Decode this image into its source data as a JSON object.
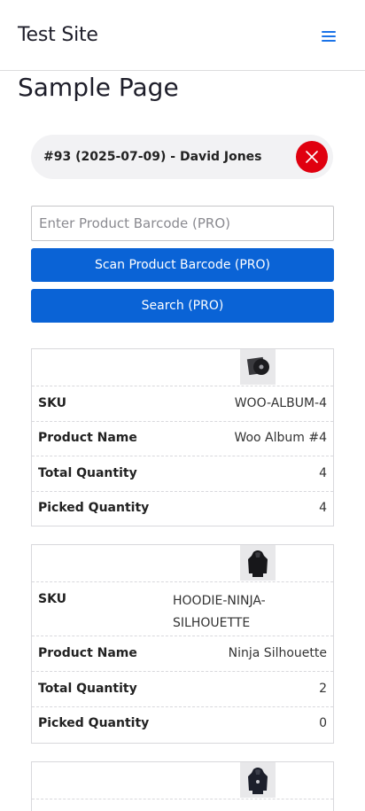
{
  "header": {
    "site_title": "Test Site",
    "menu_icon": "hamburger-menu-icon"
  },
  "page": {
    "title": "Sample Page"
  },
  "order": {
    "label": "#93 (2025-07-09) - David Jones",
    "close_icon": "close-icon",
    "close_color": "#e0000f"
  },
  "search": {
    "placeholder": "Enter Product Barcode (PRO)",
    "value": "",
    "scan_button": "Scan Product Barcode (PRO)",
    "search_button": "Search (PRO)",
    "accent": "#0a63d6"
  },
  "products": [
    {
      "image_icon": "album-thumbnail-icon",
      "rows": [
        {
          "label": "SKU",
          "value": "WOO-ALBUM-4"
        },
        {
          "label": "Product Name",
          "value": "Woo Album #4"
        },
        {
          "label": "Total Quantity",
          "value": "4"
        },
        {
          "label": "Picked Quantity",
          "value": "4"
        }
      ]
    },
    {
      "image_icon": "hoodie-thumbnail-icon",
      "rows": [
        {
          "label": "SKU",
          "value": "HOODIE-NINJA-SILHOUETTE"
        },
        {
          "label": "Product Name",
          "value": "Ninja Silhouette"
        },
        {
          "label": "Total Quantity",
          "value": "2"
        },
        {
          "label": "Picked Quantity",
          "value": "0"
        }
      ]
    },
    {
      "image_icon": "hoodie-thumbnail-icon",
      "rows": []
    }
  ]
}
